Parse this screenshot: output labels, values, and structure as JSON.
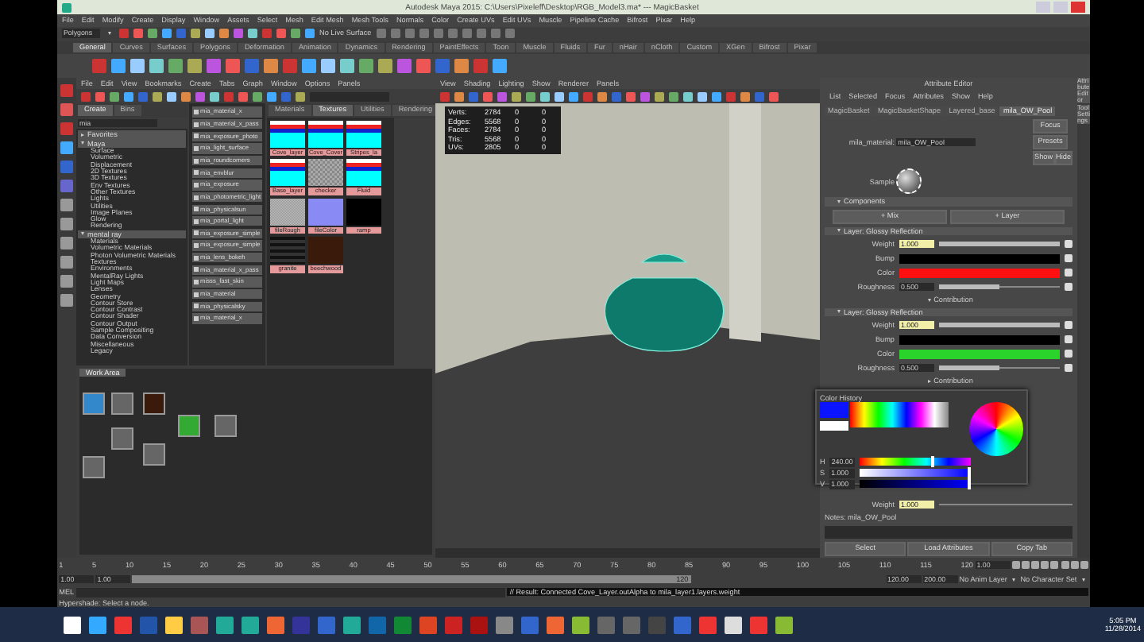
{
  "window": {
    "title": "Autodesk Maya 2015: C:\\Users\\Pixeleff\\Desktop\\RGB_Model3.ma*  ---  MagicBasket"
  },
  "menu_bar": [
    "File",
    "Edit",
    "Modify",
    "Create",
    "Display",
    "Window",
    "Assets",
    "Select",
    "Mesh",
    "Edit Mesh",
    "Mesh Tools",
    "Normals",
    "Color",
    "Create UVs",
    "Edit UVs",
    "Muscle",
    "Pipeline Cache",
    "Bifrost",
    "Pixar",
    "Help"
  ],
  "mode_menu": "Polygons",
  "live_surface": "No Live Surface",
  "shelf_tabs": [
    {
      "label": "General",
      "selected": true
    },
    {
      "label": "Curves",
      "selected": false
    },
    {
      "label": "Surfaces",
      "selected": false
    },
    {
      "label": "Polygons",
      "selected": false
    },
    {
      "label": "Deformation",
      "selected": false
    },
    {
      "label": "Animation",
      "selected": false
    },
    {
      "label": "Dynamics",
      "selected": false
    },
    {
      "label": "Rendering",
      "selected": false
    },
    {
      "label": "PaintEffects",
      "selected": false
    },
    {
      "label": "Toon",
      "selected": false
    },
    {
      "label": "Muscle",
      "selected": false
    },
    {
      "label": "Fluids",
      "selected": false
    },
    {
      "label": "Fur",
      "selected": false
    },
    {
      "label": "nHair",
      "selected": false
    },
    {
      "label": "nCloth",
      "selected": false
    },
    {
      "label": "Custom",
      "selected": false
    },
    {
      "label": "XGen",
      "selected": false
    },
    {
      "label": "Bifrost",
      "selected": false
    },
    {
      "label": "Pixar",
      "selected": false
    }
  ],
  "hypershade": {
    "menu": [
      "File",
      "Edit",
      "View",
      "Bookmarks",
      "Create",
      "Tabs",
      "Graph",
      "Window",
      "Options",
      "Panels"
    ],
    "create_tabs": [
      {
        "label": "Create",
        "selected": true
      },
      {
        "label": "Bins",
        "selected": false
      }
    ],
    "search": {
      "value": "mia"
    },
    "tree": [
      {
        "label": "Favorites",
        "expanded": false
      },
      {
        "label": "Maya",
        "expanded": true,
        "children": [
          {
            "label": "Surface"
          },
          {
            "label": "Volumetric"
          },
          {
            "label": "Displacement"
          },
          {
            "label": "2D Textures"
          },
          {
            "label": "3D Textures"
          },
          {
            "label": "Env Textures"
          },
          {
            "label": "Other Textures"
          },
          {
            "label": "Lights"
          },
          {
            "label": "Utilities"
          },
          {
            "label": "Image Planes"
          },
          {
            "label": "Glow"
          },
          {
            "label": "Rendering"
          }
        ]
      },
      {
        "label": "mental ray",
        "expanded": true,
        "children": [
          {
            "label": "Materials"
          },
          {
            "label": "Volumetric Materials"
          },
          {
            "label": "Photon Volumetric Materials"
          },
          {
            "label": "Textures"
          },
          {
            "label": "Environments"
          },
          {
            "label": "MentalRay Lights"
          },
          {
            "label": "Light Maps"
          },
          {
            "label": "Lenses"
          },
          {
            "label": "Geometry"
          },
          {
            "label": "Contour Store"
          },
          {
            "label": "Contour Contrast"
          },
          {
            "label": "Contour Shader"
          },
          {
            "label": "Contour Output"
          },
          {
            "label": "Sample Compositing"
          },
          {
            "label": "Data Conversion"
          },
          {
            "label": "Miscellaneous"
          },
          {
            "label": "Legacy"
          }
        ]
      }
    ],
    "nodes": [
      "mia_material_x",
      "mia_material_x_pass",
      "mia_exposure_photo",
      "mia_light_surface",
      "mia_roundcorners",
      "mia_envblur",
      "mia_exposure",
      "mia_photometric_light",
      "mia_physicalsun",
      "mia_portal_light",
      "mia_exposure_simple",
      "mia_exposure_simple",
      "mia_lens_bokeh",
      "mia_material_x_pass",
      "misss_fast_skin",
      "mia_material",
      "mia_physicalsky",
      "mia_material_x"
    ],
    "bin_tabs": [
      {
        "label": "Materials",
        "selected": false
      },
      {
        "label": "Textures",
        "selected": true
      },
      {
        "label": "Utilities",
        "selected": false
      },
      {
        "label": "Rendering",
        "selected": false
      }
    ],
    "swatches": [
      {
        "label": "Cove_layer",
        "kind": "stripes"
      },
      {
        "label": "Cove_Cover",
        "kind": "stripes"
      },
      {
        "label": "Stripes_la",
        "kind": "stripes"
      },
      {
        "label": "Base_layer",
        "kind": "stripes"
      },
      {
        "label": "checker",
        "kind": "checker"
      },
      {
        "label": "Fluid",
        "kind": "stripes"
      },
      {
        "label": "fileRough",
        "kind": "noise"
      },
      {
        "label": "fileColor",
        "kind": "violet"
      },
      {
        "label": "ramp",
        "kind": "black"
      },
      {
        "label": "granite",
        "kind": "dark"
      },
      {
        "label": "beechwood",
        "kind": "wood"
      }
    ],
    "work_area_tab": "Work Area"
  },
  "viewport": {
    "menu": [
      "View",
      "Shading",
      "Lighting",
      "Show",
      "Renderer",
      "Panels"
    ],
    "hud": [
      [
        "Verts:",
        "2784",
        "0",
        "0"
      ],
      [
        "Edges:",
        "5568",
        "0",
        "0"
      ],
      [
        "Faces:",
        "2784",
        "0",
        "0"
      ],
      [
        "Tris:",
        "5568",
        "0",
        "0"
      ],
      [
        "UVs:",
        "2805",
        "0",
        "0"
      ]
    ]
  },
  "attribute_editor": {
    "title": "Attribute Editor",
    "menu": [
      "List",
      "Selected",
      "Focus",
      "Attributes",
      "Show",
      "Help"
    ],
    "node_tabs": [
      {
        "label": "MagicBasket",
        "selected": false
      },
      {
        "label": "MagicBasketShape",
        "selected": false
      },
      {
        "label": "Layered_base",
        "selected": false
      },
      {
        "label": "mila_OW_Pool",
        "selected": true
      }
    ],
    "node_label": "mila_material:",
    "node_value": "mila_OW_Pool",
    "side_buttons": [
      "Focus",
      "Presets"
    ],
    "show_hide": [
      "Show",
      "Hide"
    ],
    "sample_label": "Sample",
    "components_title": "Components",
    "component_buttons": [
      "+ Mix",
      "+ Layer"
    ],
    "sections": [
      {
        "title": "Layer: Glossy Reflection",
        "rows": [
          {
            "label": "Weight",
            "kind": "number",
            "value": "1.000",
            "level": 1
          },
          {
            "label": "Bump",
            "kind": "color",
            "color": "#000000"
          },
          {
            "label": "Color",
            "kind": "color",
            "color": "#ff1010"
          },
          {
            "label": "Roughness",
            "kind": "number",
            "value": "0.500",
            "level": 0.5
          }
        ],
        "footer": "Contribution",
        "footer_expanded": true
      },
      {
        "title": "Layer: Glossy Reflection",
        "rows": [
          {
            "label": "Weight",
            "kind": "number",
            "value": "1.000",
            "level": 1
          },
          {
            "label": "Bump",
            "kind": "color",
            "color": "#000000"
          },
          {
            "label": "Color",
            "kind": "color",
            "color": "#2ad42a"
          },
          {
            "label": "Roughness",
            "kind": "number",
            "value": "0.500",
            "level": 0.5
          }
        ],
        "footer": "Contribution",
        "footer_expanded": false
      }
    ],
    "last_weight": {
      "label": "Weight",
      "value": "1.000"
    },
    "notes": "Notes:  mila_OW_Pool",
    "buttons": [
      "Select",
      "Load Attributes",
      "Copy Tab"
    ]
  },
  "color_picker": {
    "title": "Color History",
    "fields": [
      {
        "label": "H",
        "value": "240.00",
        "level": 0.66
      },
      {
        "label": "S",
        "value": "1.000",
        "level": 1
      },
      {
        "label": "V",
        "value": "1.000",
        "level": 1
      }
    ]
  },
  "side_tabs": [
    "Attribute Editor",
    "Tool Settings"
  ],
  "time_slider": {
    "ticks": [
      "1",
      "5",
      "10",
      "15",
      "20",
      "25",
      "30",
      "35",
      "40",
      "45",
      "50",
      "55",
      "60",
      "65",
      "70",
      "75",
      "80",
      "85",
      "90",
      "95",
      "100",
      "105",
      "110",
      "115",
      "120"
    ],
    "current": "1.00"
  },
  "range_slider": {
    "start": "1.00",
    "inner_start": "1.00",
    "inner_end": "120",
    "end_field": "120.00",
    "max_field": "200.00",
    "anim_layer": "No Anim Layer",
    "character_set": "No Character Set"
  },
  "command_line": {
    "label": "MEL",
    "result": "// Result: Connected Cove_Layer.outAlpha to mila_layer1.layers.weight"
  },
  "help_line": "Hypershade: Select a node.",
  "taskbar": {
    "time": "5:05 PM",
    "date": "11/28/2014"
  }
}
